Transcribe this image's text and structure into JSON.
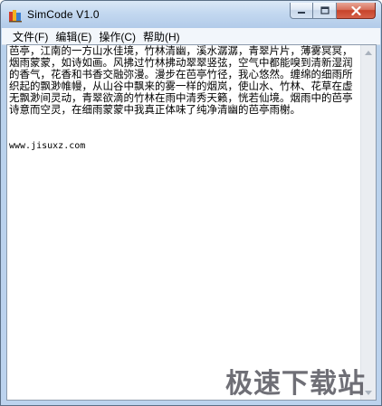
{
  "window": {
    "title": "SimCode V1.0"
  },
  "menu": [
    {
      "label": "文件(F)"
    },
    {
      "label": "编辑(E)"
    },
    {
      "label": "操作(C)"
    },
    {
      "label": "帮助(H)"
    }
  ],
  "editor": {
    "body_text": "芭亭，江南的一方山水佳境，竹林清幽，溪水潺潺，青翠片片，薄雾冥冥，烟雨蒙蒙，如诗如画。风拂过竹林拂动翠翠竖弦，空气中都能嗅到清新湿润的香气，花香和书香交融弥漫。漫步在芭亭竹径，我心悠然。缠绵的细雨所织起的飘渺帷幔，从山谷中飘来的雾一样的烟岚，使山水、竹林、花草在虚无飘渺间灵动，青翠欲滴的竹林在雨中清秀天籁，恍若仙境。烟雨中的芭亭诗意而空灵，在细雨蒙蒙中我真正体味了纯净清幽的芭亭雨榭。",
    "url_line": "www.jisuxz.com"
  },
  "watermark": {
    "text": "极速下载站"
  },
  "colors": {
    "title_bar": "#c3d8f0",
    "close_button": "#c7432a",
    "editor_bg": "#ffffff"
  },
  "icons": {
    "app": "app-books-icon",
    "minimize": "minimize-icon",
    "maximize": "maximize-icon",
    "close": "close-icon",
    "scroll_up": "chevron-up-icon",
    "scroll_down": "chevron-down-icon"
  }
}
